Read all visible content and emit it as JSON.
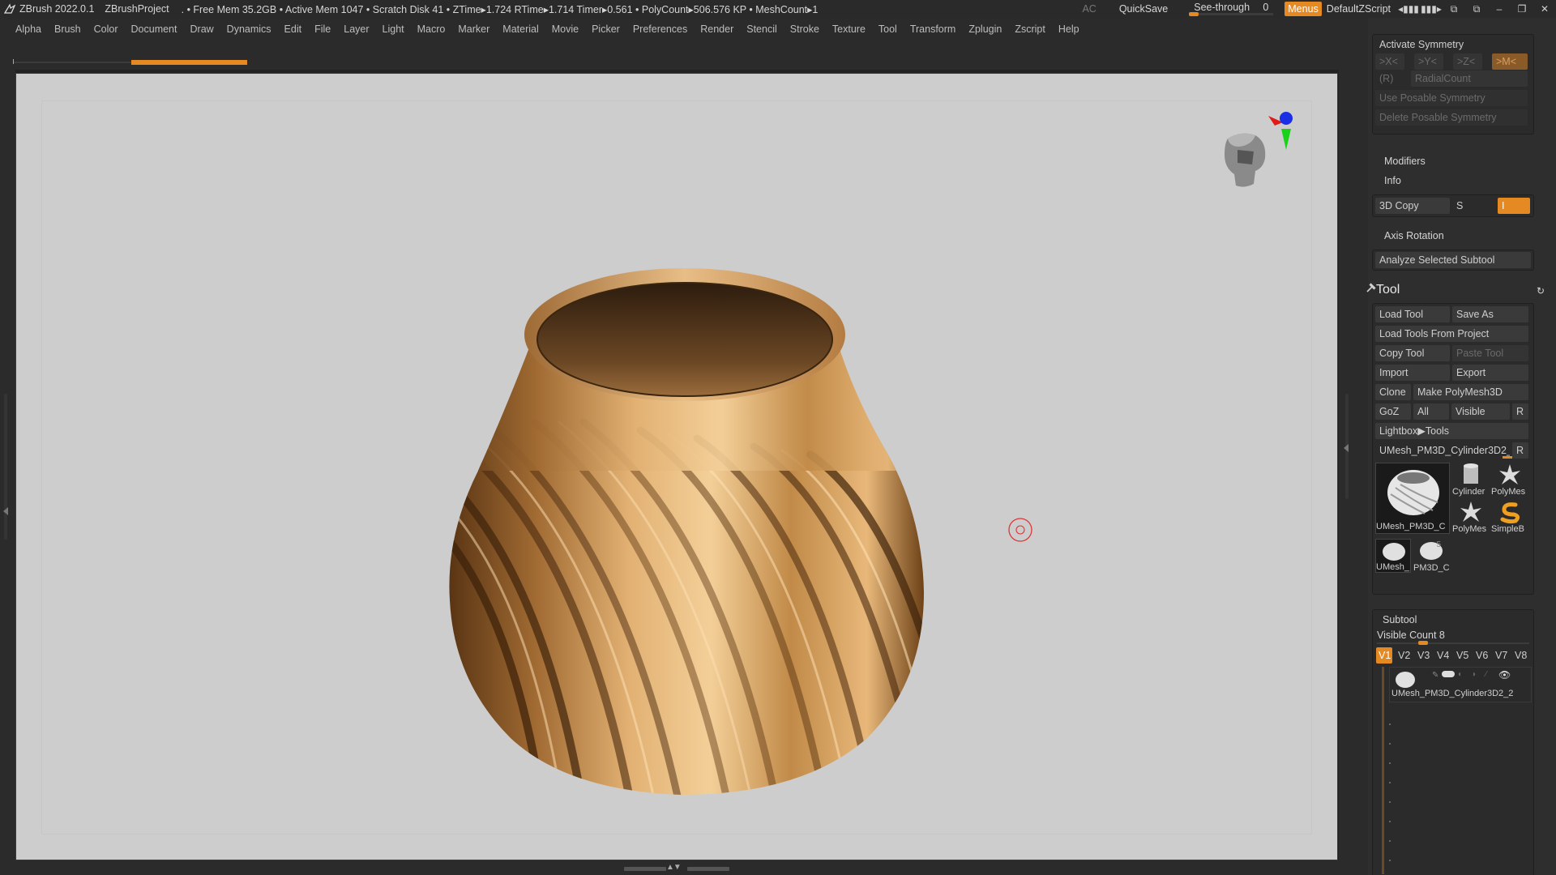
{
  "titlebar": {
    "app_version": "ZBrush 2022.0.1",
    "project": "ZBrushProject",
    "stats": ". • Free Mem 35.2GB • Active Mem 1047 • Scratch Disk 41 •  ZTime▸1.724 RTime▸1.714 Timer▸0.561 • PolyCount▸506.576 KP  • MeshCount▸1",
    "ac": "AC",
    "quicksave": "QuickSave",
    "see_through_label": "See-through",
    "see_through_value": "0",
    "see_through_level": 0,
    "menus": "Menus",
    "default_script": "DefaultZScript"
  },
  "menubar": {
    "items": [
      "Alpha",
      "Brush",
      "Color",
      "Document",
      "Draw",
      "Dynamics",
      "Edit",
      "File",
      "Layer",
      "Light",
      "Macro",
      "Marker",
      "Material",
      "Movie",
      "Picker",
      "Preferences",
      "Render",
      "Stencil",
      "Stroke",
      "Texture",
      "Tool",
      "Transform",
      "Zplugin",
      "Zscript",
      "Help"
    ]
  },
  "accent_color": "#e58a22",
  "panel": {
    "symmetry": {
      "activate": "Activate Symmetry",
      "x": ">X<",
      "y": ">Y<",
      "z": ">Z<",
      "m": ">M<",
      "r": "(R)",
      "radial_count": "RadialCount",
      "use_posable": "Use Posable Symmetry",
      "delete_posable": "Delete Posable Symmetry"
    },
    "modifiers": "Modifiers",
    "info": "Info",
    "copy3d": "3D Copy",
    "copy3d_s": "S",
    "copy3d_i": "I",
    "axis_rotation": "Axis Rotation",
    "analyze": "Analyze Selected Subtool",
    "tool": {
      "title": "Tool",
      "load_tool": "Load Tool",
      "save_as": "Save As",
      "load_from_project": "Load Tools From Project",
      "copy_tool": "Copy Tool",
      "paste_tool": "Paste Tool",
      "import": "Import",
      "export": "Export",
      "clone": "Clone",
      "make_polymesh": "Make PolyMesh3D",
      "goz": "GoZ",
      "all": "All",
      "visible": "Visible",
      "r": "R",
      "lightbox_tools": "Lightbox▶Tools",
      "current_tool": "UMesh_PM3D_Cylinder3D2_2",
      "current_r": "R",
      "thumbs": [
        {
          "label": "UMesh_PM3D_C",
          "icon": "pot-thumb-icon"
        },
        {
          "label": "Cylinder",
          "icon": "cylinder-thumb-icon"
        },
        {
          "label": "PolyMes",
          "icon": "star-thumb-icon"
        },
        {
          "label": "PolyMes",
          "icon": "star-thumb-icon"
        },
        {
          "label": "SimpleB",
          "icon": "simplebrush-thumb-icon"
        },
        {
          "label": "UMesh_",
          "icon": "pot-thumb-icon"
        },
        {
          "label": "PM3D_C",
          "icon": "pot-thumb-icon"
        }
      ],
      "thumb_small_count": "5"
    },
    "subtool": {
      "title": "Subtool",
      "visible_count": "Visible Count 8",
      "tabs": [
        "V1",
        "V2",
        "V3",
        "V4",
        "V5",
        "V6",
        "V7",
        "V8"
      ],
      "active_tab": "V1",
      "item_name": "UMesh_PM3D_Cylinder3D2_2"
    }
  }
}
